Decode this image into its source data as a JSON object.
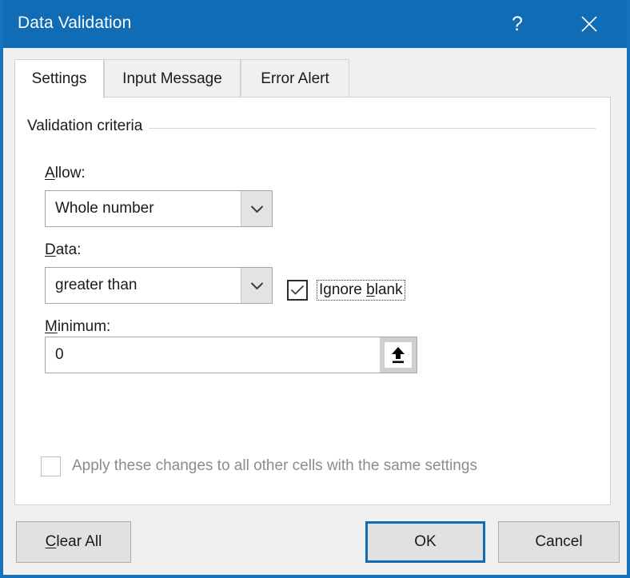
{
  "window": {
    "title": "Data Validation",
    "help_icon": "question-mark-icon",
    "close_icon": "close-icon",
    "accent_color": "#0f6cb5"
  },
  "tabs": [
    {
      "label": "Settings",
      "selected": true
    },
    {
      "label": "Input Message",
      "selected": false
    },
    {
      "label": "Error Alert",
      "selected": false
    }
  ],
  "settings": {
    "group_title": "Validation criteria",
    "allow": {
      "label_prefix": "",
      "label_accel": "A",
      "label_suffix": "llow:",
      "value": "Whole number",
      "arrow_icon": "chevron-down-icon"
    },
    "data": {
      "label_accel": "D",
      "label_suffix": "ata:",
      "value": "greater than",
      "arrow_icon": "chevron-down-icon"
    },
    "minimum": {
      "label_accel": "M",
      "label_suffix": "inimum:",
      "value": "0",
      "range_icon": "collapse-dialog-arrow-icon"
    },
    "ignore_blank": {
      "label_before": "I",
      "label_mid": "gnore ",
      "label_accel": "b",
      "label_after": "lank",
      "checked": true,
      "focused": true
    },
    "apply_all": {
      "label": "Apply these changes to all other cells with the same settings",
      "checked": false,
      "disabled": true
    }
  },
  "footer": {
    "clear_all": {
      "accel": "C",
      "suffix": "lear All"
    },
    "ok": "OK",
    "cancel": "Cancel"
  }
}
